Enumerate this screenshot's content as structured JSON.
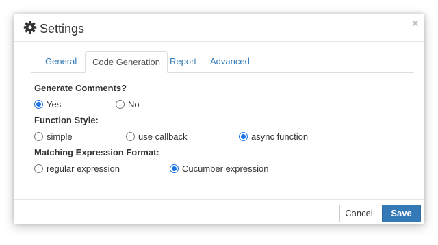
{
  "dialog": {
    "title": "Settings",
    "icon": "gear-icon",
    "close_label": "×"
  },
  "tabs": [
    {
      "label": "General",
      "active": false
    },
    {
      "label": "Code Generation",
      "active": true
    },
    {
      "label": "Report",
      "active": false
    },
    {
      "label": "Advanced",
      "active": false
    }
  ],
  "sections": {
    "comments": {
      "label": "Generate Comments?",
      "options": [
        {
          "label": "Yes",
          "checked": true
        },
        {
          "label": "No",
          "checked": false
        }
      ]
    },
    "function_style": {
      "label": "Function Style:",
      "options": [
        {
          "label": "simple",
          "checked": false
        },
        {
          "label": "use callback",
          "checked": false
        },
        {
          "label": "async function",
          "checked": true
        }
      ]
    },
    "matching": {
      "label": "Matching Expression Format:",
      "options": [
        {
          "label": "regular expression",
          "checked": false
        },
        {
          "label": "Cucumber expression",
          "checked": true
        }
      ]
    }
  },
  "footer": {
    "cancel_label": "Cancel",
    "save_label": "Save"
  },
  "colors": {
    "accent": "#337ab7",
    "radio_checked": "#1a73e8"
  }
}
